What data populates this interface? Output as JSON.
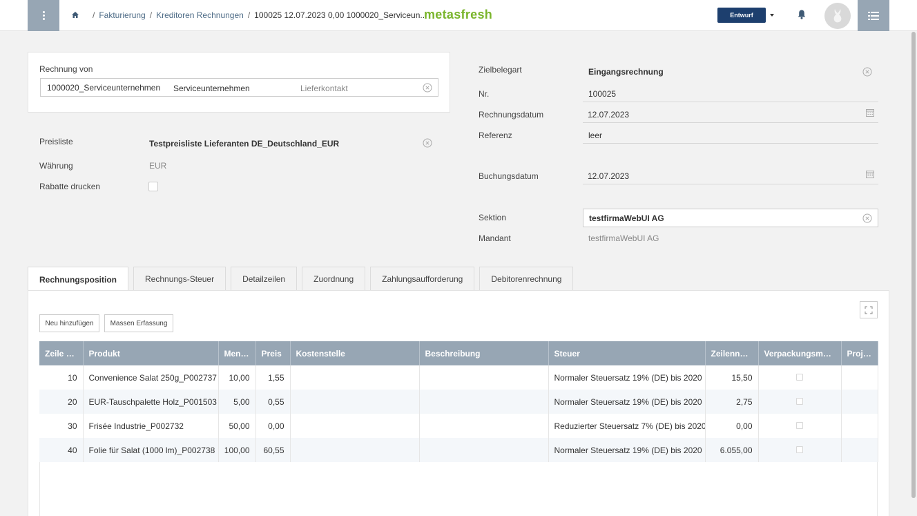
{
  "header": {
    "breadcrumb": [
      "Fakturierung",
      "Kreditoren Rechnungen"
    ],
    "current": "100025 12.07.2023 0,00 1000020_Serviceun...",
    "brand": "metasfresh",
    "status": "Entwurf"
  },
  "left": {
    "rechnung_von_label": "Rechnung von",
    "partner_value": "1000020_Serviceunternehmen",
    "location_value": "Serviceunternehmen",
    "contact_placeholder": "Lieferkontakt",
    "preisliste_label": "Preisliste",
    "preisliste_value": "Testpreisliste Lieferanten DE_Deutschland_EUR",
    "waehrung_label": "Währung",
    "waehrung_value": "EUR",
    "rabatte_label": "Rabatte drucken"
  },
  "right": {
    "zielbelegart_label": "Zielbelegart",
    "zielbelegart_value": "Eingangsrechnung",
    "nr_label": "Nr.",
    "nr_value": "100025",
    "rechnungsdatum_label": "Rechnungsdatum",
    "rechnungsdatum_value": "12.07.2023",
    "referenz_label": "Referenz",
    "referenz_value": "leer",
    "buchungsdatum_label": "Buchungsdatum",
    "buchungsdatum_value": "12.07.2023",
    "sektion_label": "Sektion",
    "sektion_value": "testfirmaWebUI AG",
    "mandant_label": "Mandant",
    "mandant_value": "testfirmaWebUI AG"
  },
  "tabs": [
    "Rechnungsposition",
    "Rechnungs-Steuer",
    "Detailzeilen",
    "Zuordnung",
    "Zahlungsaufforderung",
    "Debitorenrechnung"
  ],
  "actions": {
    "neu": "Neu hinzufügen",
    "massen": "Massen Erfassung"
  },
  "grid": {
    "columns": [
      "Zeile Nr.",
      "Produkt",
      "Menge",
      "Preis",
      "Kostenstelle",
      "Beschreibung",
      "Steuer",
      "Zeilennetto",
      "Verpackungsmat...",
      "Projekt"
    ],
    "rows": [
      {
        "zeile": "10",
        "produkt": "Convenience Salat 250g_P002737",
        "menge": "10,00",
        "preis": "1,55",
        "steuer": "Normaler Steuersatz 19% (DE) bis 2020",
        "netto": "15,50"
      },
      {
        "zeile": "20",
        "produkt": "EUR-Tauschpalette Holz_P001503",
        "menge": "5,00",
        "preis": "0,55",
        "steuer": "Normaler Steuersatz 19% (DE) bis 2020",
        "netto": "2,75"
      },
      {
        "zeile": "30",
        "produkt": "Frisée Industrie_P002732",
        "menge": "50,00",
        "preis": "0,00",
        "steuer": "Reduzierter Steuersatz 7% (DE) bis 2020",
        "netto": "0,00"
      },
      {
        "zeile": "40",
        "produkt": "Folie für Salat (1000 lm)_P002738",
        "menge": "100,00",
        "preis": "60,55",
        "steuer": "Normaler Steuersatz 19% (DE) bis 2020",
        "netto": "6.055,00"
      }
    ]
  },
  "colors": {
    "header_bg": "#97a6b4",
    "brand": "#7ab52c",
    "status_bg": "#1d3f6e"
  }
}
